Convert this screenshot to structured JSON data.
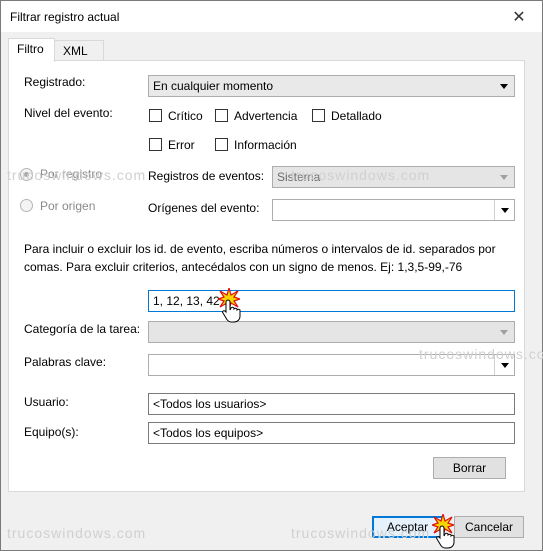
{
  "window": {
    "title": "Filtrar registro actual",
    "close_glyph": "✕"
  },
  "tabs": [
    {
      "label": "Filtro",
      "active": true
    },
    {
      "label": "XML",
      "active": false
    }
  ],
  "filter": {
    "registrado_label": "Registrado:",
    "registrado_value": "En cualquier momento",
    "nivel_label": "Nivel del evento:",
    "levels": [
      {
        "label": "Crítico",
        "checked": false
      },
      {
        "label": "Advertencia",
        "checked": false
      },
      {
        "label": "Detallado",
        "checked": false
      },
      {
        "label": "Error",
        "checked": false
      },
      {
        "label": "Información",
        "checked": false
      }
    ],
    "por_registro_label": "Por registro",
    "por_origen_label": "Por origen",
    "registros_label": "Registros de eventos:",
    "registros_value": "Sistema",
    "origenes_label": "Orígenes del evento:",
    "origenes_value": "",
    "info_text": "Para incluir o excluir los id. de evento, escriba números o intervalos de id. separados por comas. Para excluir criterios, antecédalos con un signo de menos. Ej: 1,3,5-99,-76",
    "event_ids_value": "1, 12, 13, 42",
    "categoria_label": "Categoría de la tarea:",
    "categoria_value": "",
    "palabras_label": "Palabras clave:",
    "palabras_value": "",
    "usuario_label": "Usuario:",
    "usuario_value": "<Todos los usuarios>",
    "equipo_label": "Equipo(s):",
    "equipo_value": "<Todos los equipos>",
    "borrar_label": "Borrar"
  },
  "footer": {
    "aceptar_label": "Aceptar",
    "cancelar_label": "Cancelar"
  },
  "watermark": "trucoswindows.com",
  "colors": {
    "accent": "#0078d7",
    "burst_fill": "#f5d400",
    "burst_stroke": "#e01010"
  }
}
